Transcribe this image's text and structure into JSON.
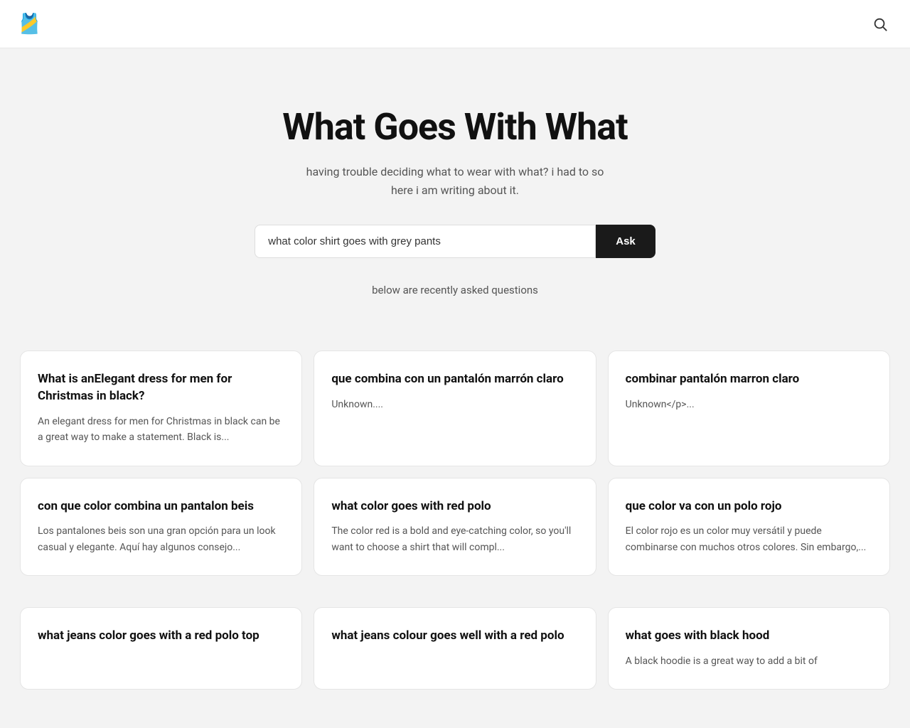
{
  "header": {
    "logo_emoji": "🎽",
    "search_icon_label": "search"
  },
  "hero": {
    "title": "What Goes With What",
    "subtitle_line1": "having trouble deciding what to wear with what? i had to so",
    "subtitle_line2": "here i am writing about it.",
    "subtitle": "having trouble deciding what to wear with what? i had to so\nhere i am writing about it."
  },
  "search": {
    "placeholder": "what color shirt goes with grey pants",
    "value": "what color shirt goes with grey pants",
    "button_label": "Ask"
  },
  "recent_label": "below are recently asked questions",
  "cards_row1": [
    {
      "title": "What is anElegant dress for men for Christmas in black?",
      "excerpt": "An elegant dress for men for Christmas in black can be a great way to make a statement. Black is..."
    },
    {
      "title": "que combina con un pantalón marrón claro",
      "excerpt": "Unknown...."
    },
    {
      "title": "combinar pantalón marron claro",
      "excerpt": "Unknown</p>..."
    }
  ],
  "cards_row2": [
    {
      "title": "con que color combina un pantalon beis",
      "excerpt": "Los pantalones beis son una gran opción para un look casual y elegante. Aquí hay algunos consejo..."
    },
    {
      "title": "what color goes with red polo",
      "excerpt": "The color red is a bold and eye-catching color, so you'll want to choose a shirt that will compl..."
    },
    {
      "title": "que color va con un polo rojo",
      "excerpt": "El color rojo es un color muy versátil y puede combinarse con muchos otros colores. Sin embargo,..."
    }
  ],
  "cards_row3": [
    {
      "title": "what jeans color goes with a red polo top",
      "excerpt": ""
    },
    {
      "title": "what jeans colour goes well with a red polo",
      "excerpt": ""
    },
    {
      "title": "what goes with black hood",
      "excerpt": "A black hoodie is a great way to add a bit of"
    }
  ]
}
